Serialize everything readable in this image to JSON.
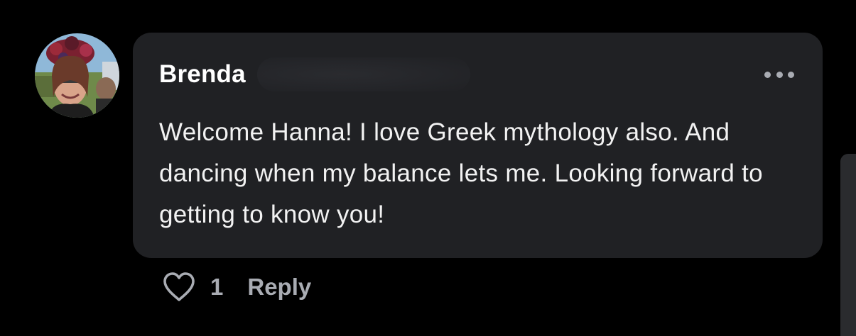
{
  "comment": {
    "author": "Brenda",
    "text": "Welcome Hanna! I love Greek mythology also. And dancing when my balance lets me. Looking forward to getting to know you!",
    "like_count": "1",
    "reply_label": "Reply"
  },
  "icons": {
    "more": "more-horizontal-icon",
    "like": "heart-outline-icon"
  },
  "colors": {
    "background": "#000000",
    "bubble": "#202124",
    "author_text": "#ffffff",
    "body_text": "#f2f2f2",
    "muted_text": "#a9acb3"
  }
}
